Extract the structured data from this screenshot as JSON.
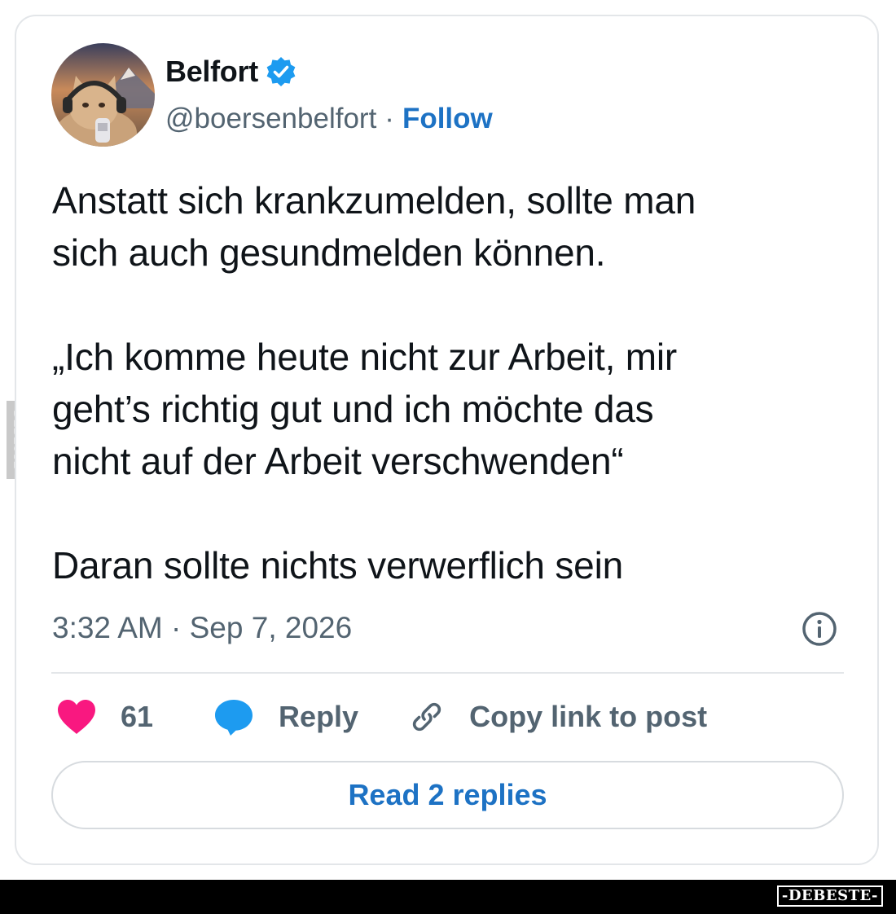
{
  "header": {
    "display_name": "Belfort",
    "handle": "@boersenbelfort",
    "separator": "·",
    "follow_label": "Follow",
    "verified_icon": "verified-badge-icon",
    "avatar_icon": "avatar-cat-headphones"
  },
  "tweet": {
    "paragraphs": [
      "Anstatt sich krankzumelden, sollte man\nsich auch gesundmelden können.",
      "„Ich komme heute nicht zur Arbeit, mir\ngeht’s richtig gut und ich möchte das\nnicht auf der Arbeit verschwenden“",
      "Daran sollte nichts verwerflich sein"
    ],
    "timestamp": "3:32 AM · Sep 7, 2026"
  },
  "actions": {
    "like_count": "61",
    "reply_label": "Reply",
    "copy_link_label": "Copy link to post"
  },
  "read_replies_label": "Read 2 replies",
  "watermark": {
    "side_text": "DEBESTE",
    "footer_text": "-DEBESTE-"
  },
  "colors": {
    "text": "#0f1419",
    "muted": "#536471",
    "link": "#1d72c4",
    "like": "#f91880",
    "reply": "#1d9bf0",
    "verified": "#1d9bf0"
  }
}
